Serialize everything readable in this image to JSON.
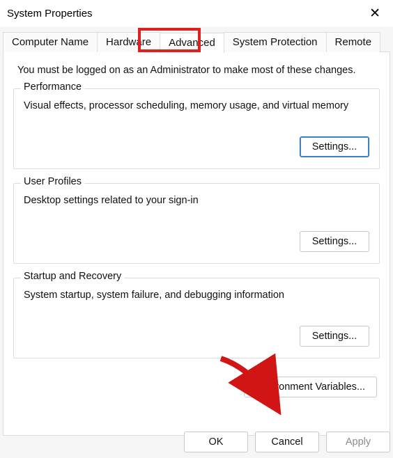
{
  "window": {
    "title": "System Properties"
  },
  "tabs": {
    "computer_name": "Computer Name",
    "hardware": "Hardware",
    "advanced": "Advanced",
    "system_protection": "System Protection",
    "remote": "Remote"
  },
  "content": {
    "intro": "You must be logged on as an Administrator to make most of these changes."
  },
  "groups": {
    "performance": {
      "legend": "Performance",
      "desc": "Visual effects, processor scheduling, memory usage, and virtual memory",
      "settings_btn": "Settings..."
    },
    "user_profiles": {
      "legend": "User Profiles",
      "desc": "Desktop settings related to your sign-in",
      "settings_btn": "Settings..."
    },
    "startup": {
      "legend": "Startup and Recovery",
      "desc": "System startup, system failure, and debugging information",
      "settings_btn": "Settings..."
    }
  },
  "env_btn": "Environment Variables...",
  "buttons": {
    "ok": "OK",
    "cancel": "Cancel",
    "apply": "Apply"
  },
  "highlight": {
    "active_tab": "advanced"
  }
}
